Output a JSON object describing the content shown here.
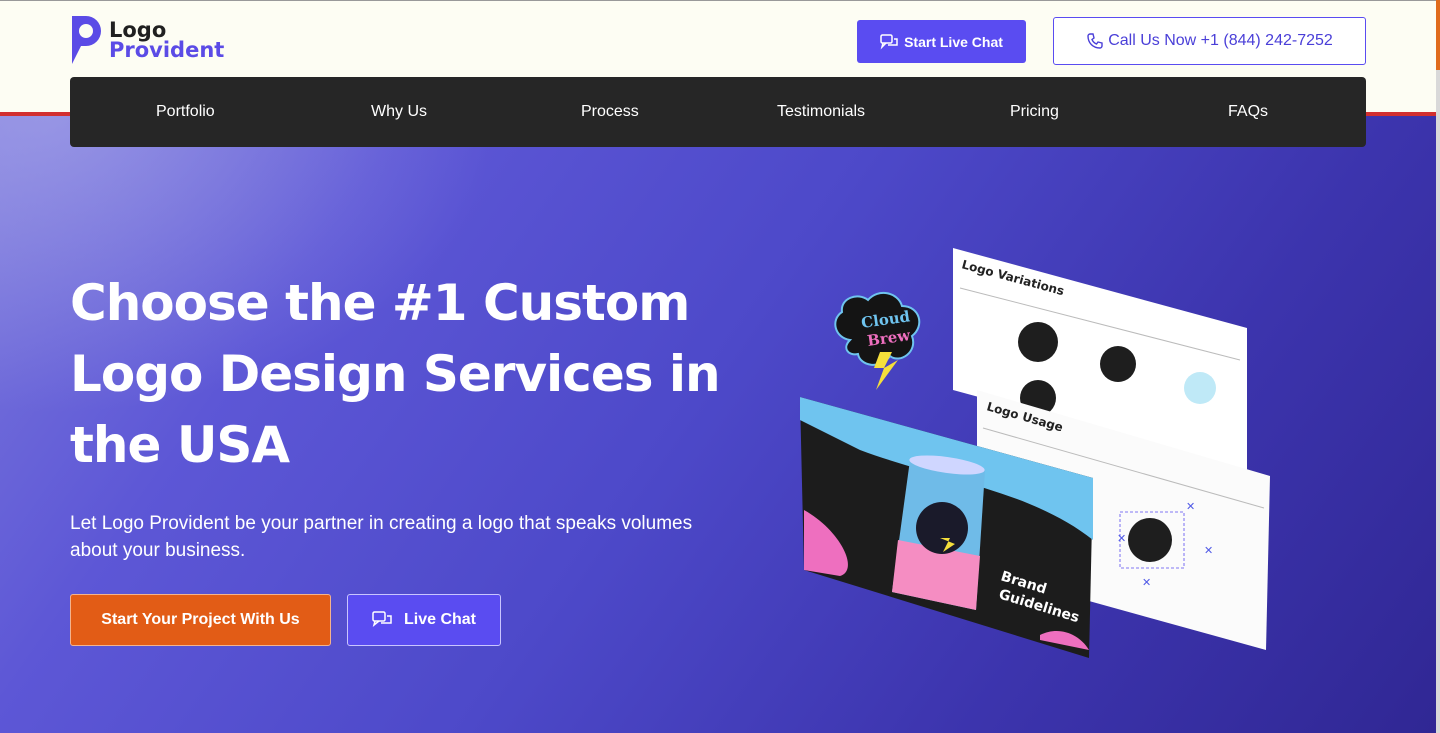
{
  "brand": {
    "line1": "Logo",
    "line2": "Provident",
    "accent_color": "#5a4cf1"
  },
  "header": {
    "chat_button": "Start Live Chat",
    "call_button": "Call Us Now +1 (844) 242-7252"
  },
  "nav": {
    "items": [
      "Portfolio",
      "Why Us",
      "Process",
      "Testimonials",
      "Pricing",
      "FAQs"
    ]
  },
  "hero": {
    "headline": "Choose the #1 Custom Logo Design Services in the USA",
    "subtext": "Let Logo Provident be your partner in creating a logo that speaks volumes about your business.",
    "primary_button": "Start Your Project With Us",
    "secondary_button": "Live Chat"
  },
  "artwork": {
    "sheet1_title": "Logo Variations",
    "sheet2_title": "Logo Usage",
    "cover_text_line1": "Brand",
    "cover_text_line2": "Guidelines",
    "sticker_line1": "Cloud",
    "sticker_line2": "Brew"
  },
  "colors": {
    "cta_orange": "#e25c16",
    "nav_bg": "#262626",
    "hero_gradient_start": "#7b78dc",
    "hero_gradient_end": "#302794"
  }
}
